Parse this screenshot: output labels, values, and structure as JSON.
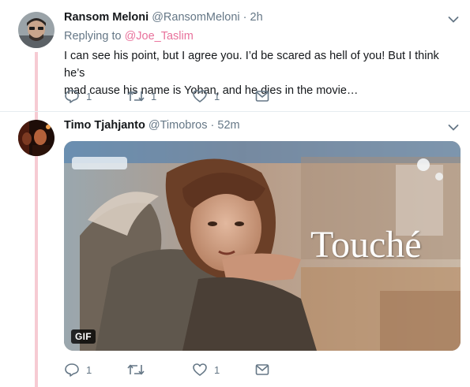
{
  "tweets": [
    {
      "display_name": "Ransom Meloni",
      "handle": "@RansomMeloni",
      "separator": "·",
      "time": "2h",
      "replying_prefix": "Replying to",
      "replying_mention": "@Joe_Taslim",
      "text_line1": "I can see his point, but I agree you. I’d be scared as hell of you! But I think he’s",
      "text_line2": "mad cause his name is Yohan, and he dies in the movie…",
      "reply_count": "1",
      "retweet_count": "1",
      "like_count": "1"
    },
    {
      "display_name": "Timo Tjahjanto",
      "handle": "@Timobros",
      "separator": "·",
      "time": "52m",
      "gif_caption": "Touché",
      "gif_badge": "GIF",
      "reply_count": "1",
      "retweet_count": "",
      "like_count": "1"
    }
  ],
  "colors": {
    "thread_line": "#f6cbd3",
    "mention": "#e1427a",
    "muted": "#657786",
    "text": "#14171a"
  },
  "icons": [
    "reply-icon",
    "retweet-icon",
    "like-icon",
    "direct-message-icon",
    "chevron-down-icon"
  ]
}
